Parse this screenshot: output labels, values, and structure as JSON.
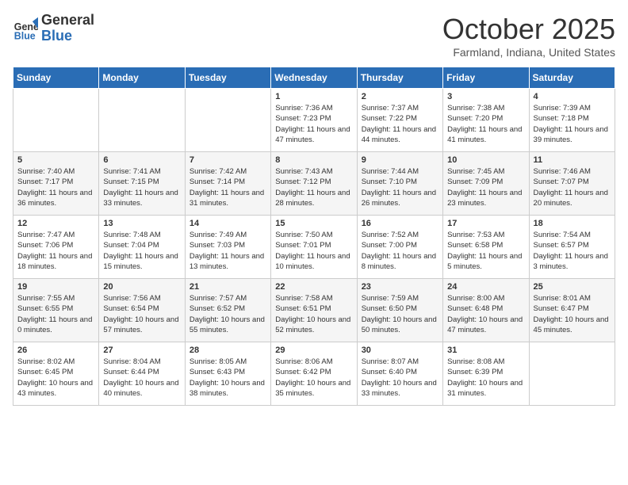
{
  "header": {
    "logo_line1": "General",
    "logo_line2": "Blue",
    "month": "October 2025",
    "location": "Farmland, Indiana, United States"
  },
  "days_of_week": [
    "Sunday",
    "Monday",
    "Tuesday",
    "Wednesday",
    "Thursday",
    "Friday",
    "Saturday"
  ],
  "weeks": [
    [
      {
        "day": "",
        "info": ""
      },
      {
        "day": "",
        "info": ""
      },
      {
        "day": "",
        "info": ""
      },
      {
        "day": "1",
        "info": "Sunrise: 7:36 AM\nSunset: 7:23 PM\nDaylight: 11 hours and 47 minutes."
      },
      {
        "day": "2",
        "info": "Sunrise: 7:37 AM\nSunset: 7:22 PM\nDaylight: 11 hours and 44 minutes."
      },
      {
        "day": "3",
        "info": "Sunrise: 7:38 AM\nSunset: 7:20 PM\nDaylight: 11 hours and 41 minutes."
      },
      {
        "day": "4",
        "info": "Sunrise: 7:39 AM\nSunset: 7:18 PM\nDaylight: 11 hours and 39 minutes."
      }
    ],
    [
      {
        "day": "5",
        "info": "Sunrise: 7:40 AM\nSunset: 7:17 PM\nDaylight: 11 hours and 36 minutes."
      },
      {
        "day": "6",
        "info": "Sunrise: 7:41 AM\nSunset: 7:15 PM\nDaylight: 11 hours and 33 minutes."
      },
      {
        "day": "7",
        "info": "Sunrise: 7:42 AM\nSunset: 7:14 PM\nDaylight: 11 hours and 31 minutes."
      },
      {
        "day": "8",
        "info": "Sunrise: 7:43 AM\nSunset: 7:12 PM\nDaylight: 11 hours and 28 minutes."
      },
      {
        "day": "9",
        "info": "Sunrise: 7:44 AM\nSunset: 7:10 PM\nDaylight: 11 hours and 26 minutes."
      },
      {
        "day": "10",
        "info": "Sunrise: 7:45 AM\nSunset: 7:09 PM\nDaylight: 11 hours and 23 minutes."
      },
      {
        "day": "11",
        "info": "Sunrise: 7:46 AM\nSunset: 7:07 PM\nDaylight: 11 hours and 20 minutes."
      }
    ],
    [
      {
        "day": "12",
        "info": "Sunrise: 7:47 AM\nSunset: 7:06 PM\nDaylight: 11 hours and 18 minutes."
      },
      {
        "day": "13",
        "info": "Sunrise: 7:48 AM\nSunset: 7:04 PM\nDaylight: 11 hours and 15 minutes."
      },
      {
        "day": "14",
        "info": "Sunrise: 7:49 AM\nSunset: 7:03 PM\nDaylight: 11 hours and 13 minutes."
      },
      {
        "day": "15",
        "info": "Sunrise: 7:50 AM\nSunset: 7:01 PM\nDaylight: 11 hours and 10 minutes."
      },
      {
        "day": "16",
        "info": "Sunrise: 7:52 AM\nSunset: 7:00 PM\nDaylight: 11 hours and 8 minutes."
      },
      {
        "day": "17",
        "info": "Sunrise: 7:53 AM\nSunset: 6:58 PM\nDaylight: 11 hours and 5 minutes."
      },
      {
        "day": "18",
        "info": "Sunrise: 7:54 AM\nSunset: 6:57 PM\nDaylight: 11 hours and 3 minutes."
      }
    ],
    [
      {
        "day": "19",
        "info": "Sunrise: 7:55 AM\nSunset: 6:55 PM\nDaylight: 11 hours and 0 minutes."
      },
      {
        "day": "20",
        "info": "Sunrise: 7:56 AM\nSunset: 6:54 PM\nDaylight: 10 hours and 57 minutes."
      },
      {
        "day": "21",
        "info": "Sunrise: 7:57 AM\nSunset: 6:52 PM\nDaylight: 10 hours and 55 minutes."
      },
      {
        "day": "22",
        "info": "Sunrise: 7:58 AM\nSunset: 6:51 PM\nDaylight: 10 hours and 52 minutes."
      },
      {
        "day": "23",
        "info": "Sunrise: 7:59 AM\nSunset: 6:50 PM\nDaylight: 10 hours and 50 minutes."
      },
      {
        "day": "24",
        "info": "Sunrise: 8:00 AM\nSunset: 6:48 PM\nDaylight: 10 hours and 47 minutes."
      },
      {
        "day": "25",
        "info": "Sunrise: 8:01 AM\nSunset: 6:47 PM\nDaylight: 10 hours and 45 minutes."
      }
    ],
    [
      {
        "day": "26",
        "info": "Sunrise: 8:02 AM\nSunset: 6:45 PM\nDaylight: 10 hours and 43 minutes."
      },
      {
        "day": "27",
        "info": "Sunrise: 8:04 AM\nSunset: 6:44 PM\nDaylight: 10 hours and 40 minutes."
      },
      {
        "day": "28",
        "info": "Sunrise: 8:05 AM\nSunset: 6:43 PM\nDaylight: 10 hours and 38 minutes."
      },
      {
        "day": "29",
        "info": "Sunrise: 8:06 AM\nSunset: 6:42 PM\nDaylight: 10 hours and 35 minutes."
      },
      {
        "day": "30",
        "info": "Sunrise: 8:07 AM\nSunset: 6:40 PM\nDaylight: 10 hours and 33 minutes."
      },
      {
        "day": "31",
        "info": "Sunrise: 8:08 AM\nSunset: 6:39 PM\nDaylight: 10 hours and 31 minutes."
      },
      {
        "day": "",
        "info": ""
      }
    ]
  ]
}
